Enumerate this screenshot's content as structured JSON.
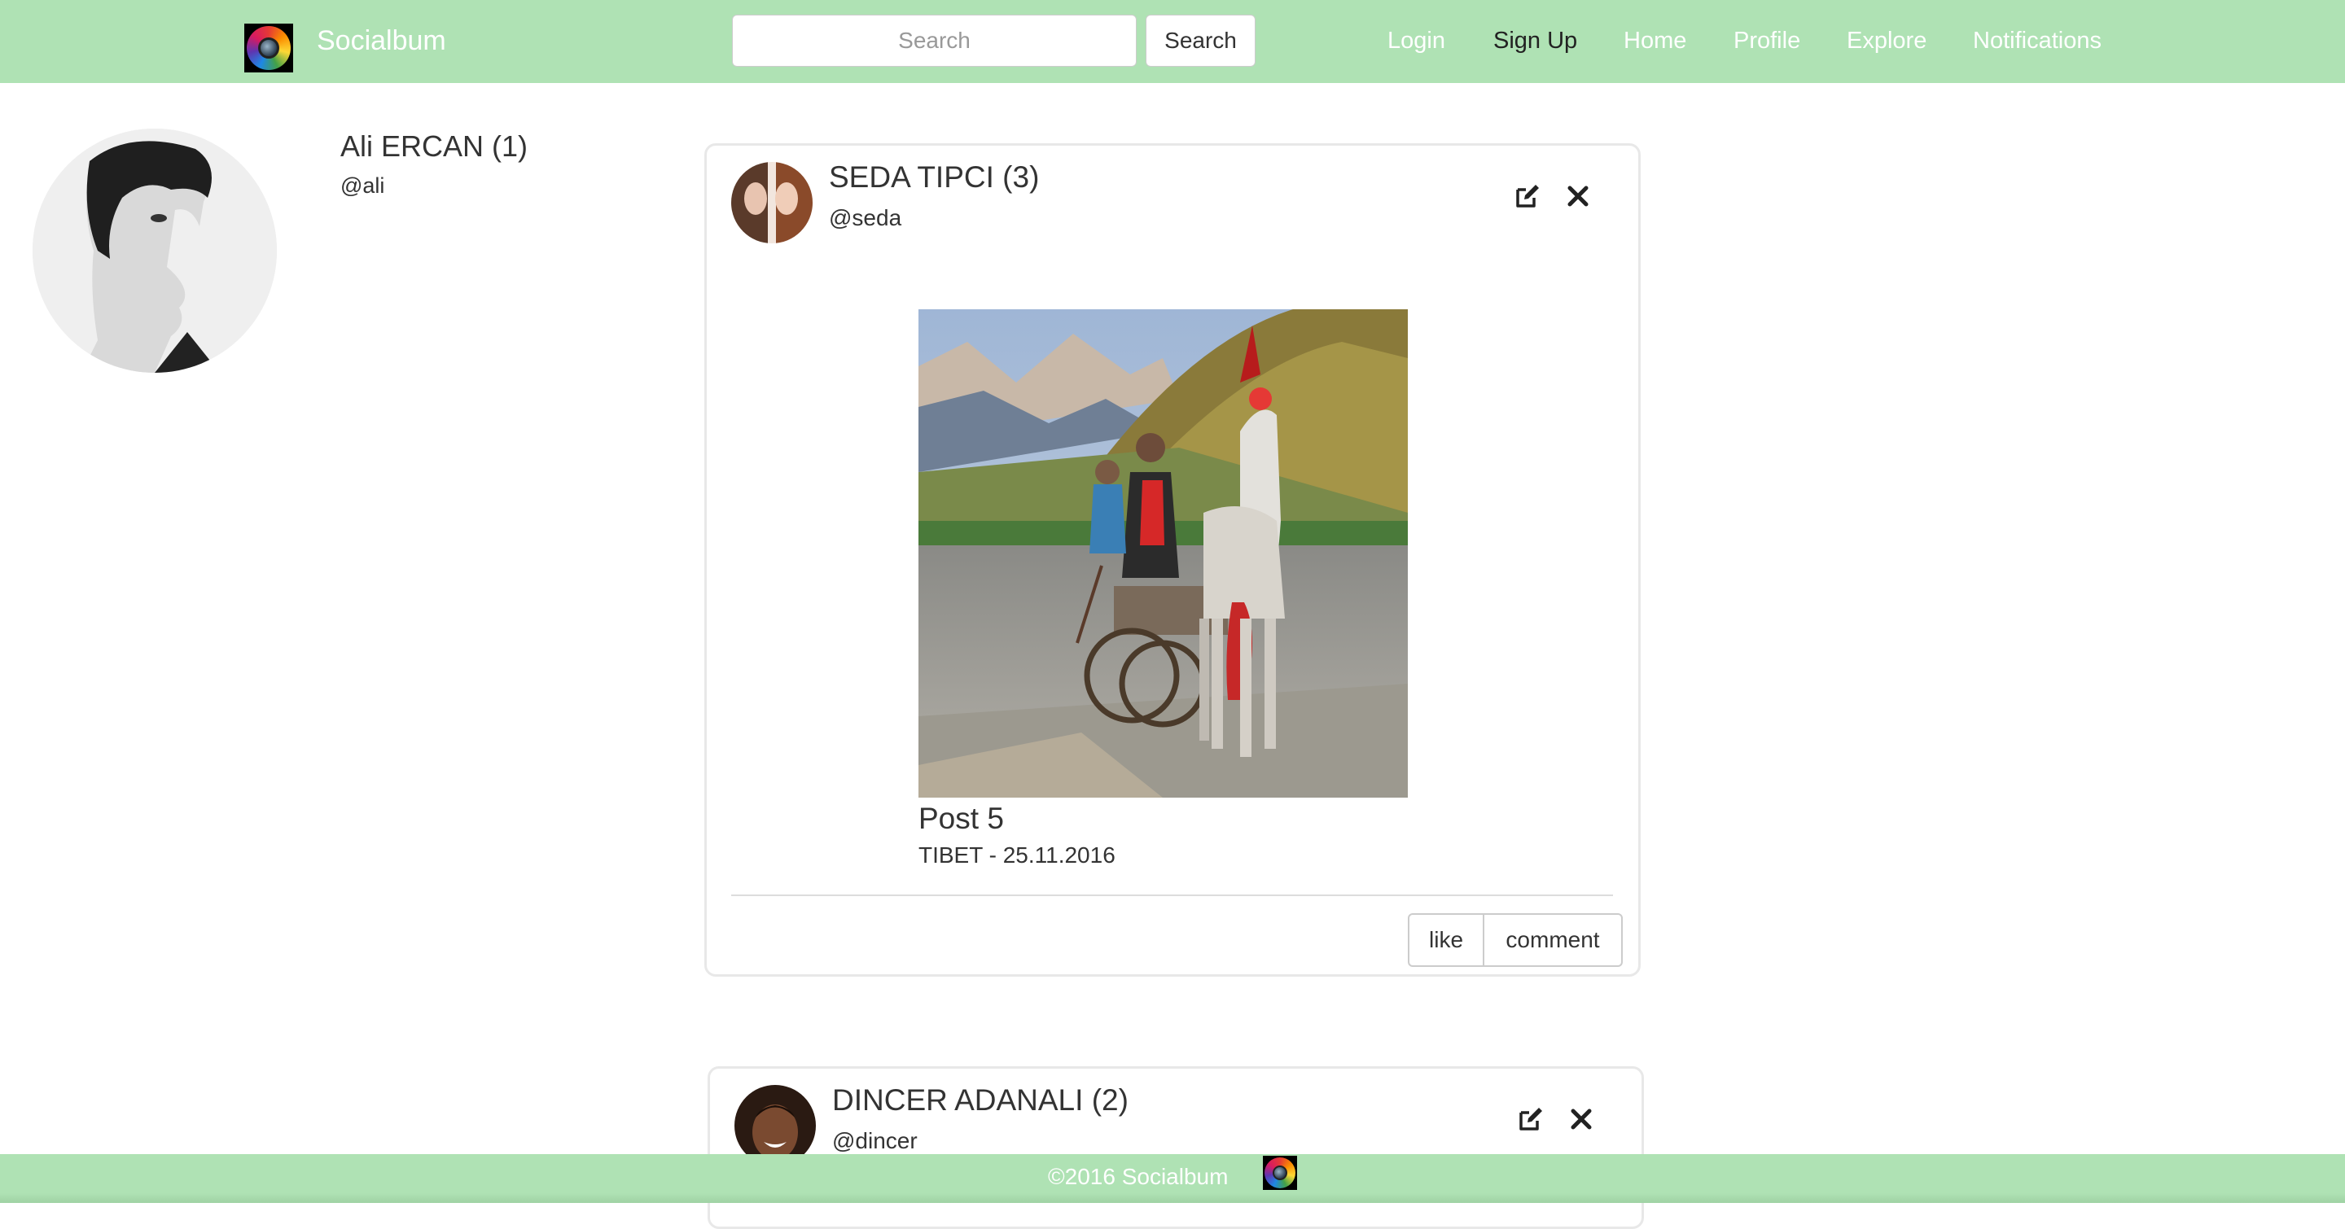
{
  "brand": {
    "name": "Socialbum",
    "logo_icon": "camera-lens-logo-icon"
  },
  "search": {
    "placeholder": "Search",
    "value": "",
    "button_label": "Search"
  },
  "nav": {
    "links": [
      "Login",
      "Sign Up",
      "Home",
      "Profile",
      "Explore",
      "Notifications"
    ]
  },
  "profile": {
    "name": "Ali ERCAN (1)",
    "handle": "@ali"
  },
  "posts": [
    {
      "author": "SEDA TIPCI (3)",
      "handle": "@seda",
      "title": "Post 5",
      "caption": "TIBET - 25.11.2016",
      "like_label": "like",
      "comment_label": "comment"
    },
    {
      "author": "DINCER ADANALI (2)",
      "handle": "@dincer"
    }
  ],
  "footer": {
    "text": "©2016 Socialbum"
  },
  "colors": {
    "navbar": "#afe2b4",
    "footer": "#afe2b4",
    "card_border": "#e8e8e8"
  }
}
